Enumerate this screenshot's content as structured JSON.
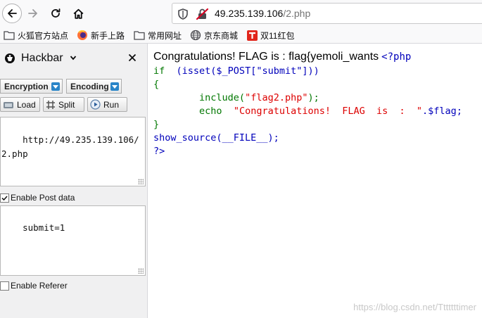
{
  "browser": {
    "url_host": "49.235.139.106",
    "url_path": "/2.php",
    "bookmarks": [
      {
        "label": "火狐官方站点",
        "icon": "folder-icon"
      },
      {
        "label": "新手上路",
        "icon": "firefox-icon"
      },
      {
        "label": "常用网址",
        "icon": "folder-icon"
      },
      {
        "label": "京东商城",
        "icon": "globe-icon"
      },
      {
        "label": "双11红包",
        "icon": "tmall-icon"
      }
    ]
  },
  "hackbar": {
    "title": "Hackbar",
    "encryption_label": "Encryption",
    "encoding_label": "Encoding",
    "load_label": "Load",
    "split_label": "Split",
    "run_label": "Run",
    "url_value": "http://49.235.139.106/2.php",
    "enable_post_label": "Enable Post data",
    "enable_post_checked": true,
    "post_value": "submit=1",
    "enable_referer_label": "Enable Referer",
    "enable_referer_checked": false
  },
  "page": {
    "congrats_text": "Congratulations! FLAG is : flag{yemoli_wants",
    "source_open": "<?php",
    "line_if_kw": "if",
    "line_if_rest": "(isset($_POST[\"submit\"]))",
    "line_open_brace": "{",
    "line_include_fn": "include(",
    "line_include_str": "\"flag2.php\"",
    "line_include_end": ");",
    "line_echo_kw": "echo",
    "line_echo_str": "\"Congratulations!  FLAG  is  :  \"",
    "line_echo_end": ".$flag;",
    "line_close_brace": "}",
    "line_show_source": "show_source(__FILE__);",
    "source_close": "?>",
    "watermark": "https://blog.csdn.net/Tttttttimer"
  },
  "colors": {
    "php_keyword": "#007700",
    "php_default": "#0000bb",
    "php_string": "#dd0000",
    "accent_blue": "#2a85c8"
  }
}
